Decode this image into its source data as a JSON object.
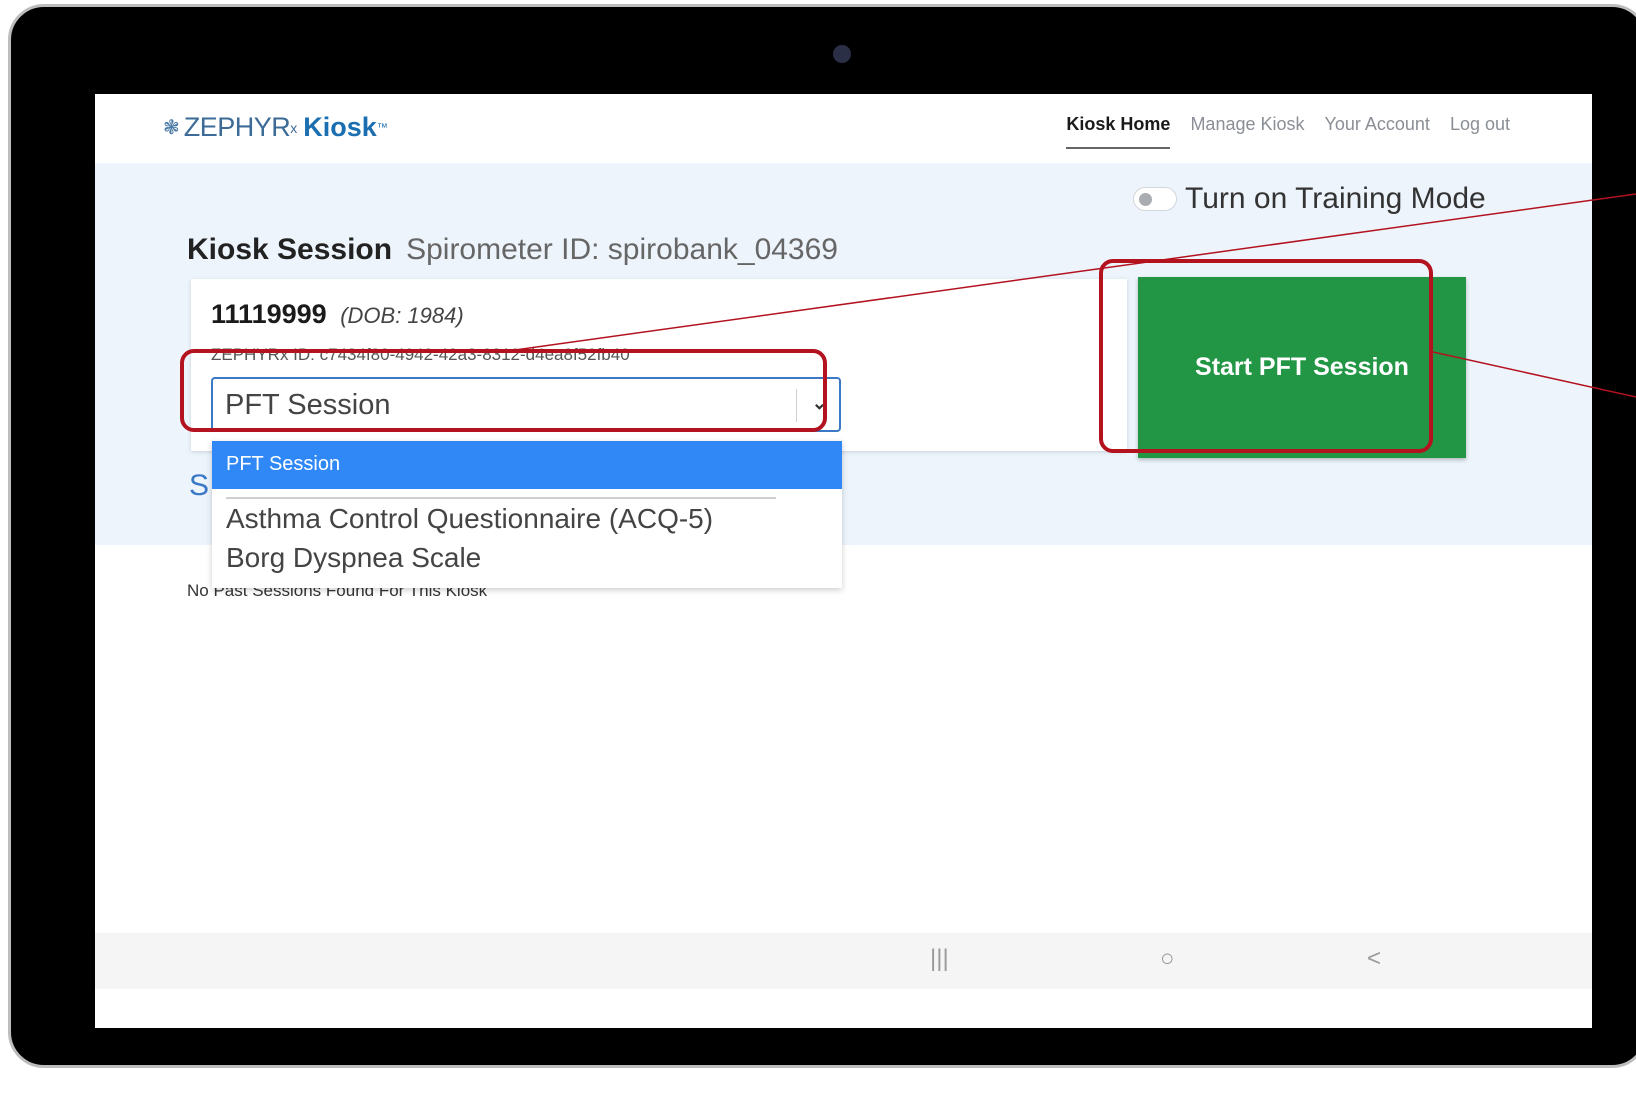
{
  "nav": {
    "logo_mark": "❃",
    "logo_brand": "ZEPHYR",
    "logo_rx": "x",
    "logo_product": "Kiosk",
    "logo_tm": "™",
    "links": [
      {
        "label": "Kiosk Home",
        "active": true
      },
      {
        "label": "Manage Kiosk",
        "active": false
      },
      {
        "label": "Your Account",
        "active": false
      },
      {
        "label": "Log out",
        "active": false
      }
    ]
  },
  "training": {
    "label": "Turn on Training Mode",
    "enabled": false
  },
  "session": {
    "title": "Kiosk Session",
    "spirometer": "Spirometer ID: spirobank_04369"
  },
  "patient": {
    "id": "11119999",
    "dob": "(DOB: 1984)",
    "zephyrx_id": "ZEPHYRx ID: c7434f80-4942-42a3-8312-d4ea8f52fb40"
  },
  "session_select": {
    "value": "PFT Session",
    "options": [
      {
        "label": "PFT Session",
        "selected": true
      },
      {
        "label": "Asthma Control Questionnaire (ACQ-5)",
        "selected": false
      },
      {
        "label": "Borg Dyspnea Scale",
        "selected": false
      }
    ]
  },
  "start_button": "Start PFT Session",
  "sessions_link_partial": "S",
  "no_past_sessions": "No Past Sessions Found For This Kiosk",
  "system_bar": {
    "recents": "|||",
    "home": "○",
    "back": "<"
  },
  "colors": {
    "primary_blue": "#2f88f5",
    "start_green": "#239645",
    "highlight_red": "#b3121f",
    "band_bg": "#edf4fc"
  }
}
